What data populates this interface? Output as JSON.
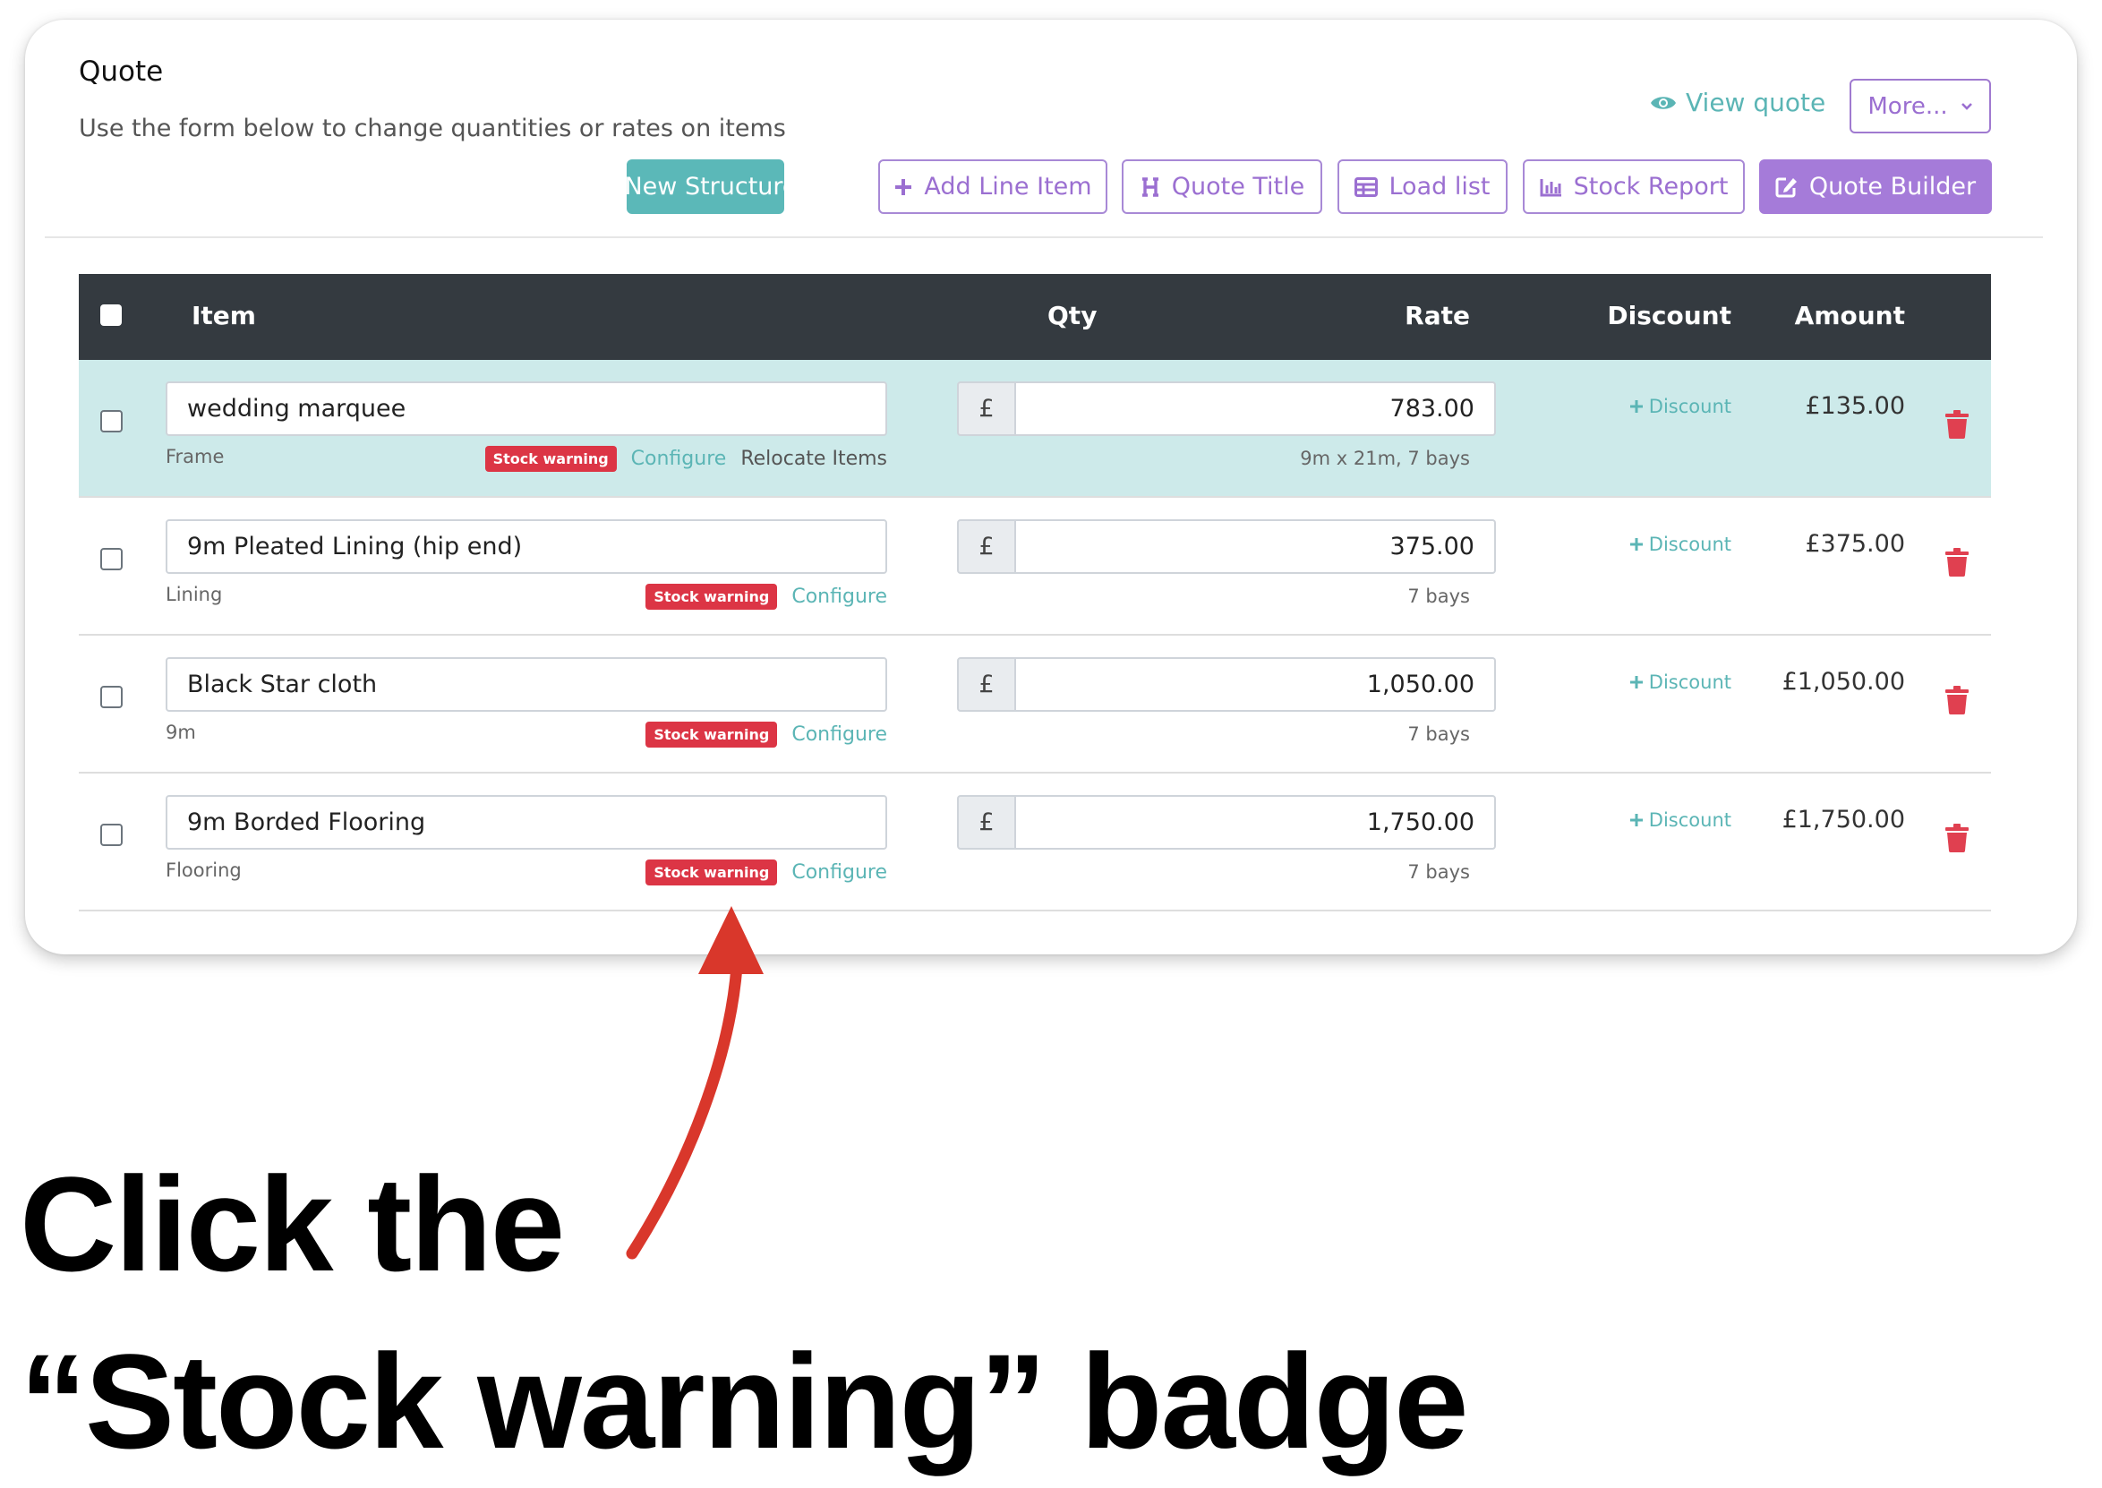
{
  "header": {
    "title": "Quote",
    "subtitle": "Use the form below to change quantities or rates on items",
    "view_quote": "View quote",
    "more": "More..."
  },
  "toolbar": {
    "new_structure": "New Structure",
    "add_line_item": "Add Line Item",
    "quote_title": "Quote Title",
    "load_list": "Load list",
    "stock_report": "Stock Report",
    "quote_builder": "Quote Builder"
  },
  "table": {
    "headers": {
      "item": "Item",
      "qty": "Qty",
      "rate": "Rate",
      "discount": "Discount",
      "amount": "Amount"
    },
    "currency_symbol": "£",
    "discount_link": "Discount",
    "stock_warning": "Stock warning",
    "configure": "Configure",
    "relocate_items": "Relocate Items",
    "rows": [
      {
        "name": "wedding marquee",
        "category": "Frame",
        "rate": "783.00",
        "rate_sub": "9m x 21m, 7 bays",
        "amount": "£135.00"
      },
      {
        "name": "9m Pleated Lining (hip end)",
        "category": "Lining",
        "rate": "375.00",
        "rate_sub": "7 bays",
        "amount": "£375.00"
      },
      {
        "name": "Black Star cloth",
        "category": "9m",
        "rate": "1,050.00",
        "rate_sub": "7 bays",
        "amount": "£1,050.00"
      },
      {
        "name": "9m Borded Flooring",
        "category": "Flooring",
        "rate": "1,750.00",
        "rate_sub": "7 bays",
        "amount": "£1,750.00"
      }
    ]
  },
  "caption": {
    "line1": "Click the",
    "line2": "“Stock warning” badge"
  },
  "colors": {
    "teal": "#5bb8b8",
    "purple": "#a57bd9",
    "danger": "#dc3545",
    "header_dark": "#343a40",
    "highlight_row": "#cdeaea",
    "arrow": "#d9372b"
  }
}
